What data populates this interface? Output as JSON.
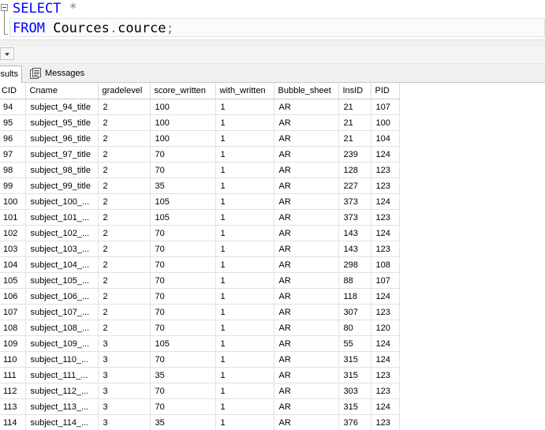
{
  "editor": {
    "line1": {
      "keyword": "SELECT",
      "star": "*"
    },
    "line2": {
      "keyword": "FROM",
      "schema": "Cources",
      "dot": ".",
      "table": "cource",
      "semicolon": ";"
    }
  },
  "tabs": {
    "results_label": "esults",
    "messages_label": "Messages"
  },
  "grid": {
    "columns": [
      "CID",
      "Cname",
      "gradelevel",
      "score_written",
      "with_written",
      "Bubble_sheet",
      "InsID",
      "PID"
    ],
    "rows": [
      [
        "94",
        "subject_94_title",
        "2",
        "100",
        "1",
        "AR",
        "21",
        "107"
      ],
      [
        "95",
        "subject_95_title",
        "2",
        "100",
        "1",
        "AR",
        "21",
        "100"
      ],
      [
        "96",
        "subject_96_title",
        "2",
        "100",
        "1",
        "AR",
        "21",
        "104"
      ],
      [
        "97",
        "subject_97_title",
        "2",
        "70",
        "1",
        "AR",
        "239",
        "124"
      ],
      [
        "98",
        "subject_98_title",
        "2",
        "70",
        "1",
        "AR",
        "128",
        "123"
      ],
      [
        "99",
        "subject_99_title",
        "2",
        "35",
        "1",
        "AR",
        "227",
        "123"
      ],
      [
        "100",
        "subject_100_...",
        "2",
        "105",
        "1",
        "AR",
        "373",
        "124"
      ],
      [
        "101",
        "subject_101_...",
        "2",
        "105",
        "1",
        "AR",
        "373",
        "123"
      ],
      [
        "102",
        "subject_102_...",
        "2",
        "70",
        "1",
        "AR",
        "143",
        "124"
      ],
      [
        "103",
        "subject_103_...",
        "2",
        "70",
        "1",
        "AR",
        "143",
        "123"
      ],
      [
        "104",
        "subject_104_...",
        "2",
        "70",
        "1",
        "AR",
        "298",
        "108"
      ],
      [
        "105",
        "subject_105_...",
        "2",
        "70",
        "1",
        "AR",
        "88",
        "107"
      ],
      [
        "106",
        "subject_106_...",
        "2",
        "70",
        "1",
        "AR",
        "118",
        "124"
      ],
      [
        "107",
        "subject_107_...",
        "2",
        "70",
        "1",
        "AR",
        "307",
        "123"
      ],
      [
        "108",
        "subject_108_...",
        "2",
        "70",
        "1",
        "AR",
        "80",
        "120"
      ],
      [
        "109",
        "subject_109_...",
        "3",
        "105",
        "1",
        "AR",
        "55",
        "124"
      ],
      [
        "110",
        "subject_110_...",
        "3",
        "70",
        "1",
        "AR",
        "315",
        "124"
      ],
      [
        "111",
        "subject_111_...",
        "3",
        "35",
        "1",
        "AR",
        "315",
        "123"
      ],
      [
        "112",
        "subject_112_...",
        "3",
        "70",
        "1",
        "AR",
        "303",
        "123"
      ],
      [
        "113",
        "subject_113_...",
        "3",
        "70",
        "1",
        "AR",
        "315",
        "124"
      ],
      [
        "114",
        "subject_114_...",
        "3",
        "35",
        "1",
        "AR",
        "376",
        "123"
      ]
    ]
  },
  "colors": {
    "keyword": "#0000ff",
    "operator": "#808080"
  }
}
